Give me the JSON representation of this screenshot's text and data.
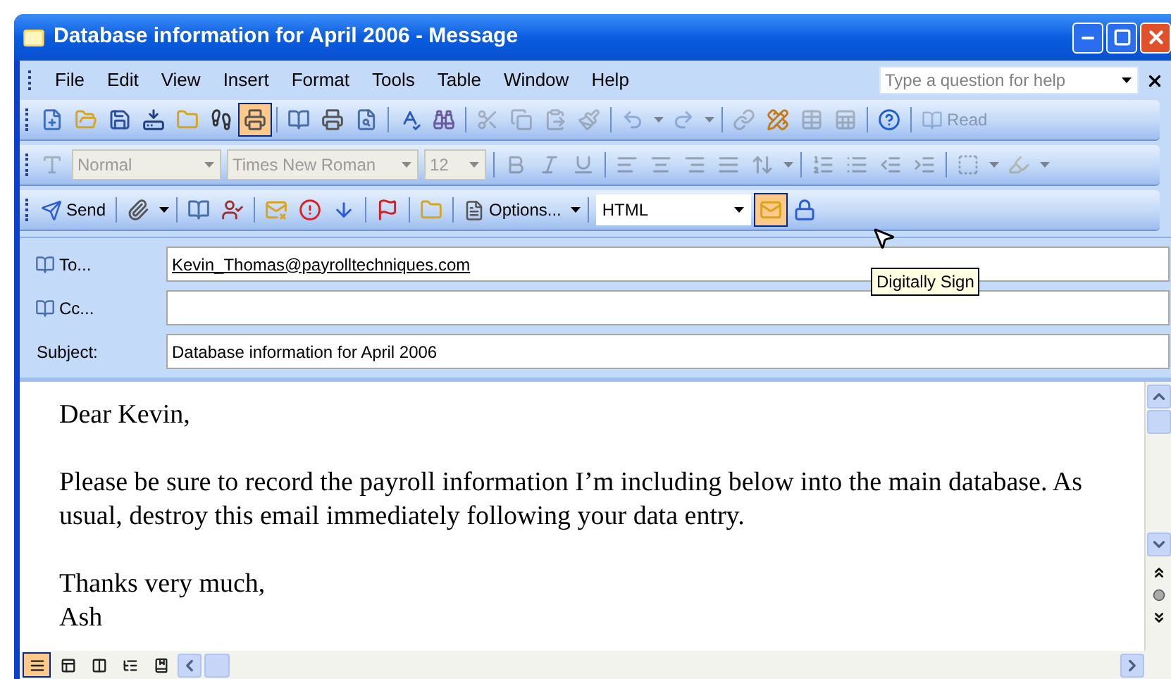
{
  "window": {
    "title": "Database information for April 2006 - Message"
  },
  "menu": {
    "items": [
      "File",
      "Edit",
      "View",
      "Insert",
      "Format",
      "Tools",
      "Table",
      "Window",
      "Help"
    ],
    "help_box": {
      "placeholder": "Type a question for help"
    }
  },
  "toolbars": [
    {
      "groups": [
        [
          {
            "kind": "new",
            "disabled": false,
            "pressed": false
          },
          {
            "kind": "open",
            "disabled": false,
            "pressed": false
          },
          {
            "kind": "save",
            "disabled": false,
            "pressed": false
          },
          {
            "kind": "saveas",
            "disabled": false,
            "pressed": false
          },
          {
            "kind": "folder",
            "disabled": false,
            "pressed": false
          },
          {
            "kind": "footprints",
            "disabled": false,
            "pressed": false
          },
          {
            "kind": "printer",
            "disabled": false,
            "pressed": true
          }
        ],
        [
          {
            "kind": "book",
            "disabled": false,
            "pressed": false
          },
          {
            "kind": "printer",
            "disabled": false,
            "pressed": false
          },
          {
            "kind": "preview",
            "disabled": false,
            "pressed": false
          }
        ],
        [
          {
            "kind": "spelling",
            "disabled": false,
            "pressed": false
          },
          {
            "kind": "research",
            "disabled": false,
            "pressed": false
          }
        ],
        [
          {
            "kind": "cut",
            "disabled": true,
            "pressed": false
          },
          {
            "kind": "copy",
            "disabled": true,
            "pressed": false
          },
          {
            "kind": "paste",
            "disabled": true,
            "pressed": false
          },
          {
            "kind": "brush",
            "disabled": true,
            "pressed": false
          }
        ],
        [
          {
            "kind": "undo",
            "disabled": true,
            "pressed": false
          },
          {
            "kind": "caret",
            "disabled": true
          },
          {
            "kind": "redo",
            "disabled": true,
            "pressed": false
          },
          {
            "kind": "caret",
            "disabled": true
          }
        ],
        [
          {
            "kind": "link",
            "disabled": true,
            "pressed": false
          },
          {
            "kind": "drawtable",
            "disabled": false,
            "pressed": false
          },
          {
            "kind": "table",
            "disabled": true,
            "pressed": false
          },
          {
            "kind": "sheet",
            "disabled": true,
            "pressed": false
          }
        ],
        [
          {
            "kind": "help",
            "disabled": false,
            "pressed": false
          }
        ],
        [
          {
            "kind": "read",
            "label": "Read",
            "disabled": true,
            "pressed": false
          }
        ]
      ]
    },
    {
      "groups": [
        [
          {
            "kind": "styles",
            "disabled": true,
            "pressed": false
          },
          {
            "kind": "stylecombo",
            "value": "Normal",
            "disabled": true
          },
          {
            "kind": "fontcombo",
            "value": "Times New Roman",
            "disabled": true
          },
          {
            "kind": "sizecombo",
            "value": "12",
            "disabled": true
          }
        ],
        [
          {
            "kind": "bold",
            "disabled": true,
            "pressed": false
          },
          {
            "kind": "italic",
            "disabled": true,
            "pressed": false
          },
          {
            "kind": "underline",
            "disabled": true,
            "pressed": false
          }
        ],
        [
          {
            "kind": "alignleft",
            "disabled": true,
            "pressed": false
          },
          {
            "kind": "aligncenter",
            "disabled": true,
            "pressed": false
          },
          {
            "kind": "alignright",
            "disabled": true,
            "pressed": false
          },
          {
            "kind": "justify",
            "disabled": true,
            "pressed": false
          },
          {
            "kind": "spacing",
            "disabled": true,
            "pressed": false
          },
          {
            "kind": "caret",
            "disabled": true
          }
        ],
        [
          {
            "kind": "numbering",
            "disabled": true,
            "pressed": false
          },
          {
            "kind": "bullets",
            "disabled": true,
            "pressed": false
          },
          {
            "kind": "outdent",
            "disabled": true,
            "pressed": false
          },
          {
            "kind": "indent",
            "disabled": true,
            "pressed": false
          }
        ],
        [
          {
            "kind": "border",
            "disabled": true,
            "pressed": false
          },
          {
            "kind": "caret",
            "disabled": true
          },
          {
            "kind": "highlight",
            "disabled": true,
            "pressed": false
          },
          {
            "kind": "caret",
            "disabled": true
          }
        ]
      ]
    },
    {
      "groups": [
        [
          {
            "kind": "send",
            "label": "Send",
            "disabled": false,
            "pressed": false
          }
        ],
        [
          {
            "kind": "paperclip",
            "disabled": false,
            "pressed": false
          },
          {
            "kind": "caret",
            "disabled": false
          }
        ],
        [
          {
            "kind": "book",
            "disabled": false,
            "pressed": false
          },
          {
            "kind": "checknames",
            "disabled": false,
            "pressed": false
          }
        ],
        [
          {
            "kind": "noentrymail",
            "disabled": false,
            "pressed": false
          },
          {
            "kind": "important",
            "disabled": false,
            "pressed": false
          },
          {
            "kind": "lowimportance",
            "disabled": false,
            "pressed": false
          }
        ],
        [
          {
            "kind": "flag",
            "disabled": false,
            "pressed": false
          }
        ],
        [
          {
            "kind": "folder",
            "disabled": false,
            "pressed": false
          }
        ],
        [
          {
            "kind": "options",
            "label": "Options...",
            "disabled": false,
            "pressed": false
          },
          {
            "kind": "caret",
            "disabled": false
          }
        ],
        [
          {
            "kind": "formatcombo",
            "value": "HTML",
            "disabled": false
          },
          {
            "kind": "sign",
            "disabled": false,
            "pressed": true
          },
          {
            "kind": "encrypt",
            "disabled": false,
            "pressed": false
          }
        ]
      ]
    }
  ],
  "fields": [
    {
      "kind": "button",
      "label": "To...",
      "value": "Kevin_Thomas@payrolltechniques.com"
    },
    {
      "kind": "button",
      "label": "Cc..."
    },
    {
      "kind": "plain",
      "label": "Subject:",
      "value": "Database information for April 2006"
    }
  ],
  "tooltip": "Digitally Sign",
  "body": {
    "paragraphs": [
      "Dear Kevin,",
      "Please be sure to record the payroll information I’m including below into the main database. As usual, destroy this email immediately following your data entry.",
      [
        "Thanks very much,",
        "Ash"
      ]
    ]
  },
  "view_buttons": [
    {
      "selected": true
    },
    {
      "selected": false
    },
    {
      "selected": false
    },
    {
      "selected": false
    },
    {
      "selected": false
    }
  ]
}
